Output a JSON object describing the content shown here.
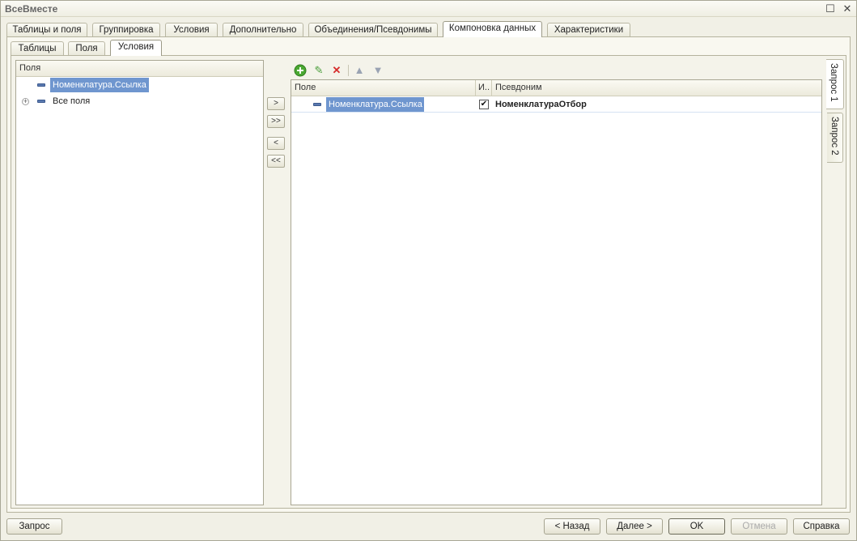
{
  "window": {
    "title": "ВсеВместе"
  },
  "titlebar": {
    "restore_glyph": "☐",
    "close_glyph": "✕"
  },
  "main_tabs": [
    {
      "label": "Таблицы и поля"
    },
    {
      "label": "Группировка"
    },
    {
      "label": "Условия"
    },
    {
      "label": "Дополнительно"
    },
    {
      "label": "Объединения/Псевдонимы"
    },
    {
      "label": "Компоновка данных"
    },
    {
      "label": "Характеристики"
    }
  ],
  "active_main_tab": "Компоновка данных",
  "sub_tabs": [
    {
      "label": "Таблицы"
    },
    {
      "label": "Поля"
    },
    {
      "label": "Условия"
    }
  ],
  "active_sub_tab": "Условия",
  "left_list": {
    "header": "Поля",
    "items": [
      {
        "label": "Номенклатура.Ссылка",
        "selected": true
      },
      {
        "label": "Все поля",
        "expandable": true
      }
    ]
  },
  "move_buttons": {
    "add": ">",
    "add_all": ">>",
    "remove": "<",
    "remove_all": "<<"
  },
  "toolbar": {
    "add_glyph": "+",
    "edit_glyph": "✎",
    "delete_glyph": "✕",
    "up_glyph": "▲",
    "down_glyph": "▼"
  },
  "right_table": {
    "columns": [
      {
        "label": "Поле"
      },
      {
        "label": "И.."
      },
      {
        "label": "Псевдоним"
      }
    ],
    "rows": [
      {
        "field": "Номенклатура.Ссылка",
        "checked": true,
        "check_glyph": "✔",
        "alias": "НоменклатураОтбор"
      }
    ]
  },
  "query_tabs": [
    {
      "label": "Запрос 1",
      "active": true
    },
    {
      "label": "Запрос 2"
    }
  ],
  "bottom_buttons": {
    "query": "Запрос",
    "back": "< Назад",
    "next": "Далее >",
    "ok": "OK",
    "cancel": "Отмена",
    "help": "Справка"
  },
  "colors": {
    "selection": "#6f96cf",
    "add_icon": "#4aa832",
    "edit_icon": "#4a9e3a",
    "delete_icon": "#d62b2b",
    "arrow_icon": "#9aa3b3"
  }
}
